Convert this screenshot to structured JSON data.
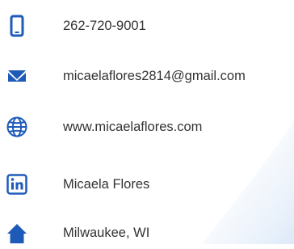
{
  "colors": {
    "icon": "#1e5bb8",
    "text": "#333333",
    "background_accent": "#e9f1fb"
  },
  "contacts": [
    {
      "icon": "smartphone-icon",
      "text": "262-720-9001"
    },
    {
      "icon": "envelope-icon",
      "text": "micaelaflores2814@gmail.com"
    },
    {
      "icon": "globe-icon",
      "text": "www.micaelaflores.com"
    },
    {
      "icon": "linkedin-icon",
      "text": "Micaela Flores"
    },
    {
      "icon": "home-icon",
      "text": "Milwaukee, WI"
    }
  ]
}
